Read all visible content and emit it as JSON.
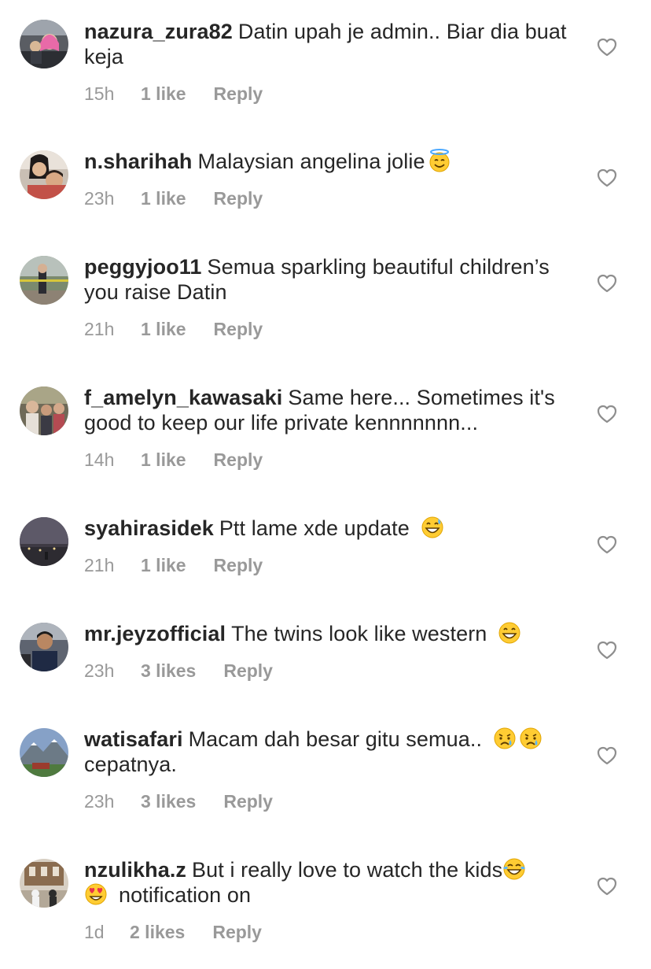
{
  "comments": [
    {
      "username": "nazura_zura82",
      "text_parts": [
        "Datin upah je admin.. Biar dia buat keja"
      ],
      "emojis": [],
      "time": "15h",
      "likes": "1 like",
      "reply": "Reply",
      "avatar": "avatar-photo-woman-car"
    },
    {
      "username": "n.sharihah",
      "text_parts": [
        "Malaysian angelina jolie"
      ],
      "emojis": [
        "smiling-face-with-halo"
      ],
      "time": "23h",
      "likes": "1 like",
      "reply": "Reply",
      "avatar": "avatar-photo-selfie"
    },
    {
      "username": "peggyjoo11",
      "text_parts": [
        "Semua sparkling beautiful children’s you raise Datin"
      ],
      "emojis": [],
      "time": "21h",
      "likes": "1 like",
      "reply": "Reply",
      "avatar": "avatar-photo-outdoor"
    },
    {
      "username": "f_amelyn_kawasaki",
      "text_parts": [
        "Same here... Sometimes it's good to keep our life private kennnnnnn..."
      ],
      "emojis": [],
      "time": "14h",
      "likes": "1 like",
      "reply": "Reply",
      "avatar": "avatar-photo-family"
    },
    {
      "username": "syahirasidek",
      "text_parts": [
        "Ptt lame xde update",
        ""
      ],
      "emojis": [
        "grinning-face-with-sweat"
      ],
      "time": "21h",
      "likes": "1 like",
      "reply": "Reply",
      "avatar": "avatar-photo-night"
    },
    {
      "username": "mr.jeyzofficial",
      "text_parts": [
        "The twins look like western",
        ""
      ],
      "emojis": [
        "grinning-face"
      ],
      "time": "23h",
      "likes": "3 likes",
      "reply": "Reply",
      "avatar": "avatar-photo-man"
    },
    {
      "username": "watisafari",
      "text_parts": [
        "Macam dah besar gitu semua..",
        "cepatnya."
      ],
      "emojis": [
        "crying-face",
        "crying-face"
      ],
      "time": "23h",
      "likes": "3 likes",
      "reply": "Reply",
      "avatar": "avatar-photo-mountain"
    },
    {
      "username": "nzulikha.z",
      "text_parts": [
        "But i really love to watch the kids",
        "notification on"
      ],
      "emojis": [
        "face-with-tears-of-joy",
        "smiling-face-with-heart-eyes"
      ],
      "time": "1d",
      "likes": "2 likes",
      "reply": "Reply",
      "avatar": "avatar-photo-building"
    }
  ],
  "colors": {
    "text": "#262626",
    "meta": "#999999",
    "heart_stroke": "#8e8e8e"
  },
  "icons": {
    "like": "heart-outline-icon"
  }
}
